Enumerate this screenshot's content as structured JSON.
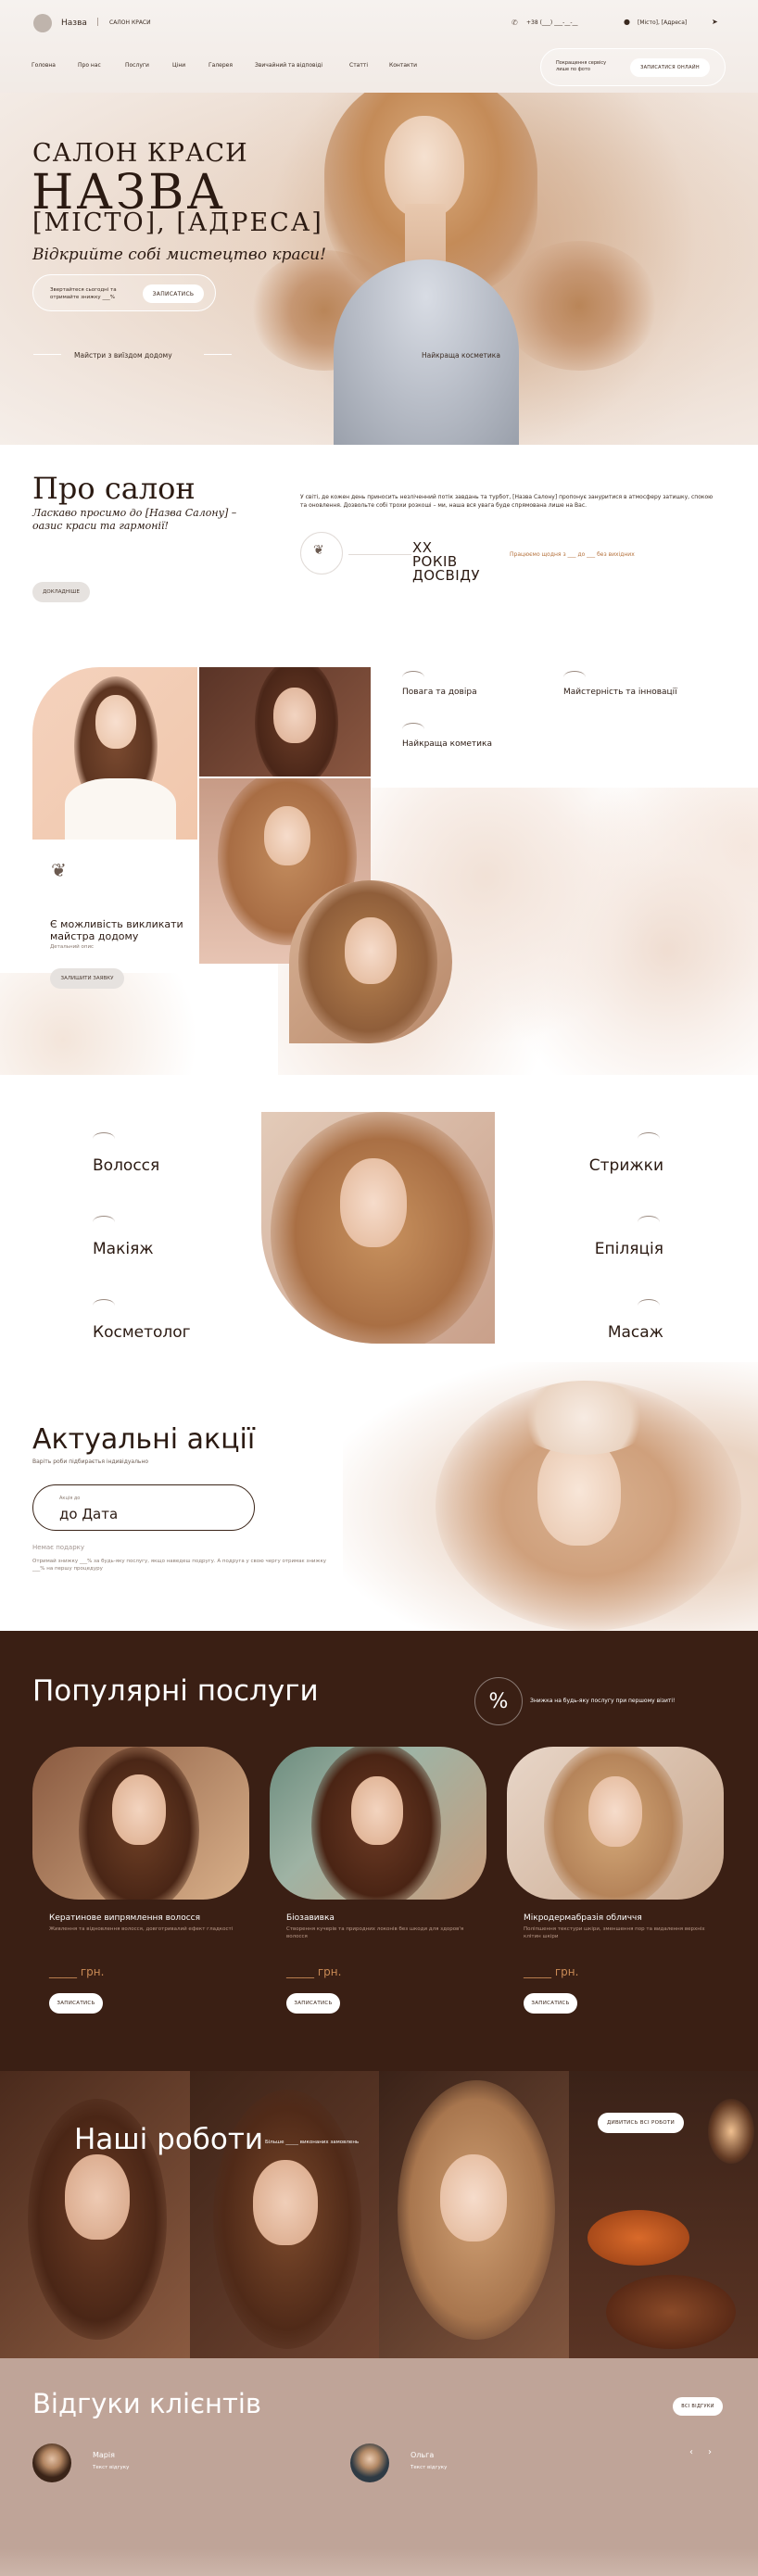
{
  "header": {
    "brand": "Назва",
    "sep": "|",
    "brand_sub": "САЛОН КРАСИ",
    "phone": "+38 (___) ___-__-__",
    "address": "[Місто], [Адреса]"
  },
  "nav": {
    "items": [
      "Головна",
      "Про нас",
      "Послуги",
      "Ціни",
      "Галерея",
      "Звичайний та відповіді",
      "Статті",
      "Контакти"
    ],
    "promo_text": "Покращення сервісу лише по фото",
    "promo_button": "ЗАПИСАТИСЯ ОНЛАЙН"
  },
  "hero": {
    "line1": "САЛОН КРАСИ",
    "line2": "НАЗВА",
    "line3": "[МІСТО], [АДРЕСА]",
    "tagline": "Відкрийте собі мистецтво краси!",
    "cta_text": "Звертайтеся сьогодні та отримайте знижку ___%",
    "cta_button": "ЗАПИСАТИСЬ",
    "feature1": "Майстри з виїздом додому",
    "feature2": "Найкраща косметика"
  },
  "about": {
    "title": "Про салон",
    "subtitle": "Ласкаво просимо до [Назва Салону] – оазис краси та гармонії!",
    "text": "У світі, де кожен день приносить незліченний потік завдань та турбот, [Назва Салону] пропонує зануритися в атмосферу затишку, спокою та оновлення. Дозвольте собі трохи розкоші – ми, наша вся увага буде спрямована лише на Вас.",
    "years": "XX РОКІВ ДОСВІДУ",
    "years_note": "Працюємо щодня з ___ до ___ без вихідних",
    "more_button": "ДОКЛАДНІШЕ"
  },
  "features": {
    "items": [
      "Повага та довіра",
      "Майстерність та інновації",
      "Найкраща кометика"
    ],
    "home_visit_title": "Є можливість викликати майстра додому",
    "home_visit_sub": "Детальний опис",
    "home_visit_button": "ЗАЛИШИТИ ЗАЯВКУ"
  },
  "services_grid": {
    "left": [
      "Волосся",
      "Макіяж",
      "Косметолог"
    ],
    "right": [
      "Стрижки",
      "Епіляція",
      "Масаж"
    ]
  },
  "promos": {
    "title": "Актуальні акції",
    "subtitle": "Варіть роби підбираєтья індивідуально",
    "box_label": "Акція до",
    "box_value": "до Дата",
    "small_title": "Немає подарку",
    "small_text": "Отримай знижку ___% за будь-яку послугу, якщо наведеш подругу. А подруга у свою чергу отримає знижку ___% на першу процедуру"
  },
  "popular": {
    "title": "Популярні послуги",
    "note": "Знижка на будь-яку послугу при першому візиті!",
    "percent": "%",
    "cards": [
      {
        "name": "Кератинове випрямлення волосся",
        "desc": "Живлення та відновлення волосся, довготривалий ефект гладкості",
        "price": "_____ грн.",
        "button": "ЗАПИСАТИСЬ"
      },
      {
        "name": "Біозавивка",
        "desc": "Створення кучерів та природних локонів без шкоди для здоров'я волосся",
        "price": "_____ грн.",
        "button": "ЗАПИСАТИСЬ"
      },
      {
        "name": "Мікродермабразія обличчя",
        "desc": "Поліпшення текстури шкіри, зменшення пор та видалення верхніх клітин шкіри",
        "price": "_____ грн.",
        "button": "ЗАПИСАТИСЬ"
      }
    ]
  },
  "works": {
    "title": "Наші роботи",
    "sub": "Більше _____ виконаних замовлень",
    "button": "ДИВИТИСЬ ВСІ РОБОТИ"
  },
  "reviews": {
    "title": "Відгуки клієнтів",
    "button": "ВСІ ВІДГУКИ",
    "items": [
      {
        "name": "Марія",
        "text": "Текст відгуку"
      },
      {
        "name": "Ольга",
        "text": "Текст відгуку"
      }
    ],
    "prev": "‹",
    "next": "›"
  },
  "colors": {
    "dark": "#3a1f14",
    "accent": "#c9a48a",
    "beige": "#bfa498",
    "gold": "#b5733e"
  }
}
